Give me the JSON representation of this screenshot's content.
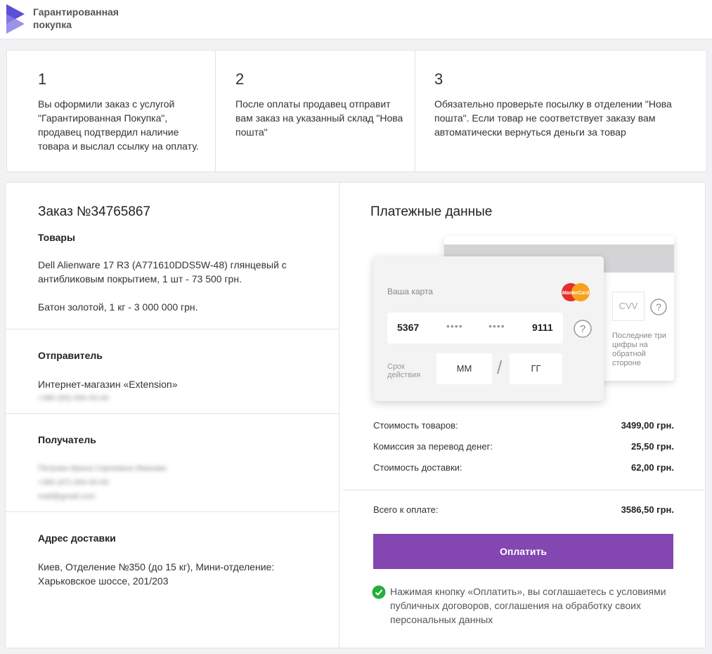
{
  "header": {
    "logo_text": "Гарантированная покупка",
    "logo_icon": "purple-chevron-logo"
  },
  "steps": [
    {
      "number": "1",
      "text": "Вы оформили заказ с услугой \"Гарантированная Покупка\", продавец подтвердил наличие товара и выслал ссылку на оплату."
    },
    {
      "number": "2",
      "text": "После оплаты продавец отправит вам заказ на указанный склад \"Нова пошта\""
    },
    {
      "number": "3",
      "text": "Обязательно проверьте посылку в отделении \"Нова пошта\". Если товар не соответствует заказу вам автоматически вернуться деньги за товар"
    }
  ],
  "order": {
    "title": "Заказ №34765867",
    "goods_title": "Товары",
    "goods": [
      "Dell Alienware 17 R3 (A771610DDS5W-48) глянцевый с антибликовым покрытием, 1 шт - 73 500 грн.",
      "Батон золотой, 1 кг - 3 000 000 грн."
    ]
  },
  "sender": {
    "title": "Отправитель",
    "name": "Интернет-магазин «Extension»",
    "phone_blurred": "+380 (50) 000-00-00"
  },
  "receiver": {
    "title": "Получатель",
    "lines_blurred": [
      "Петрова Ирина Сергеевна Иванова",
      "+380 (67) 000-00-00",
      "mail@gmail.com"
    ]
  },
  "address": {
    "title": "Адрес доставки",
    "text": "Киев, Отделение №350 (до 15 кг), Мини-отделение: Харьковское  шоссе, 201/203"
  },
  "payment": {
    "title": "Платежные данные",
    "card": {
      "label": "Ваша карта",
      "brand": "MasterCard",
      "num_first": "5367",
      "num_mask1": "••••",
      "num_mask2": "••••",
      "num_last": "9111",
      "expiry_label": "Срок действия",
      "month_placeholder": "ММ",
      "year_placeholder": "ГГ",
      "cvv_placeholder": "CVV",
      "cvv_hint": "Последние три цифры на обратной стороне"
    },
    "rows": [
      {
        "label": "Стоимость товаров:",
        "value": "3499,00 грн."
      },
      {
        "label": "Комиссия за перевод денег:",
        "value": "25,50 грн."
      },
      {
        "label": "Стоимость доставки:",
        "value": "62,00 грн."
      }
    ],
    "total_label": "Всего к оплате:",
    "total_value": "3586,50 грн.",
    "pay_button": "Оплатить",
    "agreement": "Нажимая кнопку «Оплатить», вы соглашаетесь с условиями публичных договоров, соглашения на обработку своих персональных данных",
    "colors": {
      "accent": "#8446b1",
      "check": "#27ae3a"
    }
  }
}
